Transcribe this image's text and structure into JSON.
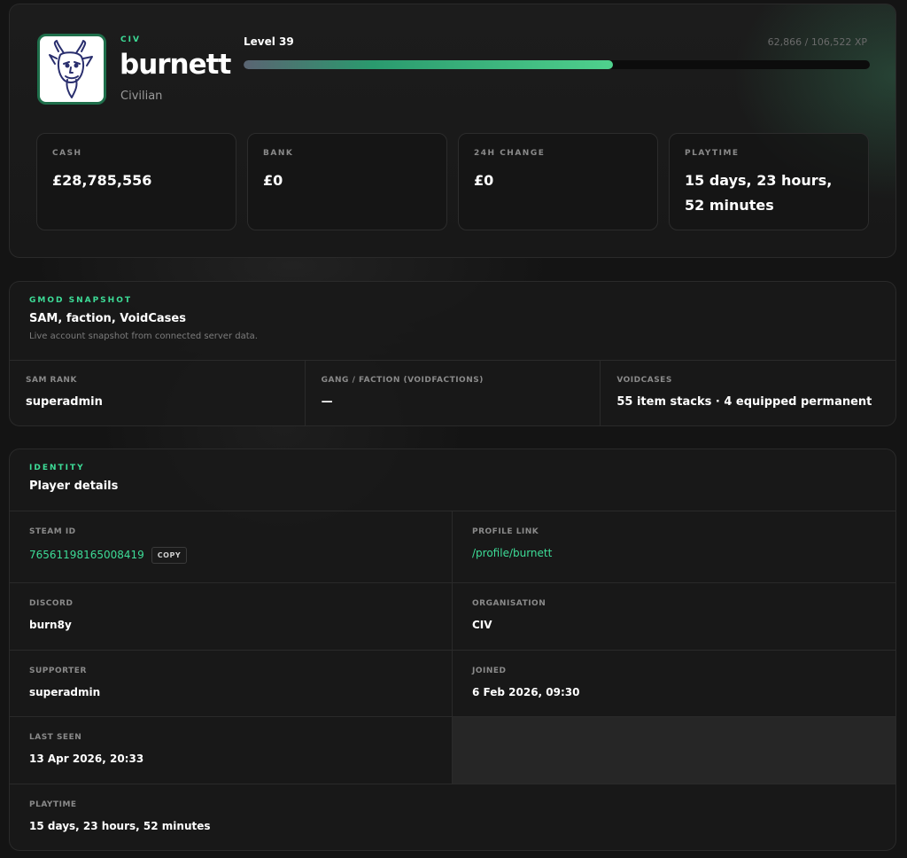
{
  "profile": {
    "org_tag": "CIV",
    "username": "burnett",
    "role": "Civilian",
    "level_label": "Level 39",
    "xp_text": "62,866 / 106,522 XP",
    "xp_fraction": 0.59
  },
  "stats": [
    {
      "label": "CASH",
      "value": "£28,785,556"
    },
    {
      "label": "BANK",
      "value": "£0"
    },
    {
      "label": "24H CHANGE",
      "value": "£0"
    },
    {
      "label": "PLAYTIME",
      "value": "15 days, 23 hours, 52 minutes"
    }
  ],
  "snapshot": {
    "eyebrow": "GMOD SNAPSHOT",
    "title": "SAM, faction, VoidCases",
    "subtitle": "Live account snapshot from connected server data.",
    "cells": [
      {
        "label": "SAM RANK",
        "value": "superadmin"
      },
      {
        "label": "GANG / FACTION (VOIDFACTIONS)",
        "value": "—"
      },
      {
        "label": "VOIDCASES",
        "value": "55 item stacks · 4 equipped permanent"
      }
    ]
  },
  "identity": {
    "eyebrow": "IDENTITY",
    "title": "Player details",
    "steam_id_label": "STEAM ID",
    "steam_id": "76561198165008419",
    "copy_label": "COPY",
    "profile_link_label": "PROFILE LINK",
    "profile_link": "/profile/burnett",
    "discord_label": "DISCORD",
    "discord": "burn8y",
    "organisation_label": "ORGANISATION",
    "organisation": "CIV",
    "supporter_label": "SUPPORTER",
    "supporter": "superadmin",
    "joined_label": "JOINED",
    "joined": "6 Feb 2026, 09:30",
    "last_seen_label": "LAST SEEN",
    "last_seen": "13 Apr 2026, 20:33",
    "playtime_label": "PLAYTIME",
    "playtime": "15 days, 23 hours, 52 minutes"
  }
}
